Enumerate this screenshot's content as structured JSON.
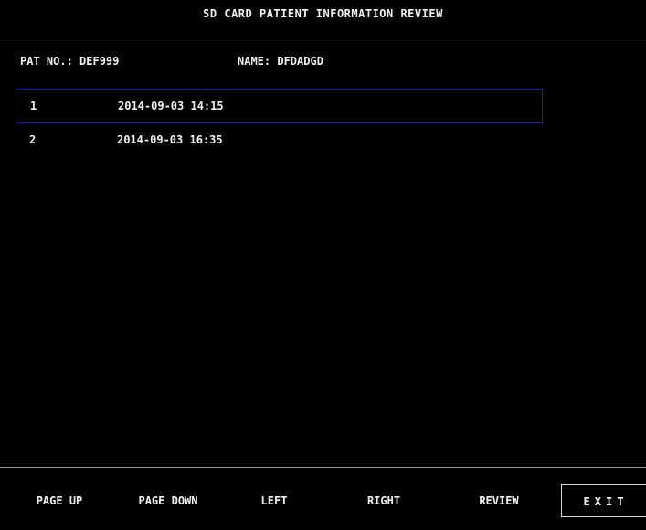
{
  "header": {
    "title": "SD CARD PATIENT INFORMATION REVIEW"
  },
  "patient": {
    "pat_no": "PAT NO.: DEF999",
    "name": "NAME: DFDADGD"
  },
  "records": [
    {
      "index": "1",
      "timestamp": "2014-09-03 14:15",
      "selected": true
    },
    {
      "index": "2",
      "timestamp": "2014-09-03 16:35",
      "selected": false
    }
  ],
  "softkeys": {
    "page_up": "PAGE UP",
    "page_down": "PAGE DOWN",
    "left": "LEFT",
    "right": "RIGHT",
    "review": "REVIEW",
    "exit": "EXIT"
  },
  "colors": {
    "background": "#000000",
    "text": "#f2f2f2",
    "selection_border": "#1c1cc8",
    "rule": "#9a9a9a"
  }
}
